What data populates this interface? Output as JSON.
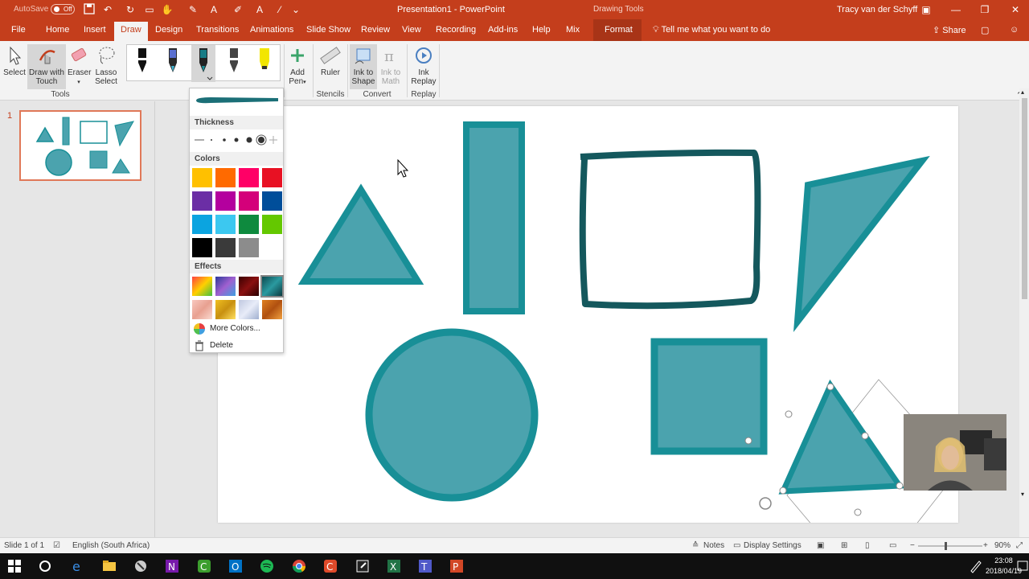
{
  "titlebar": {
    "autosave_label": "AutoSave",
    "autosave_state": "Off",
    "doc_title": "Presentation1 - PowerPoint",
    "contextual_label": "Drawing Tools",
    "user_name": "Tracy van der Schyff",
    "accent": "#c43e1c"
  },
  "tabs": [
    "File",
    "Home",
    "Insert",
    "Draw",
    "Design",
    "Transitions",
    "Animations",
    "Slide Show",
    "Review",
    "View",
    "Recording",
    "Add-ins",
    "Help",
    "Mix",
    "Format"
  ],
  "active_tab": "Draw",
  "tell_me": "Tell me what you want to do",
  "share_label": "Share",
  "ribbon": {
    "select": "Select",
    "draw_with_touch_1": "Draw with",
    "draw_with_touch_2": "Touch",
    "eraser": "Eraser",
    "lasso_1": "Lasso",
    "lasso_2": "Select",
    "tools_group": "Tools",
    "add_pen_1": "Add",
    "add_pen_2": "Pen",
    "ruler": "Ruler",
    "stencils_group": "Stencils",
    "ink_to_shape_1": "Ink to",
    "ink_to_shape_2": "Shape",
    "ink_to_math_1": "Ink to",
    "ink_to_math_2": "Math",
    "convert_group": "Convert",
    "ink_replay_1": "Ink",
    "ink_replay_2": "Replay",
    "replay_group": "Replay"
  },
  "pen_dropdown": {
    "thickness_heading": "Thickness",
    "colors_heading": "Colors",
    "effects_heading": "Effects",
    "more_colors": "More Colors...",
    "delete": "Delete",
    "colors": [
      "#ffc000",
      "#ff6a00",
      "#ff0066",
      "#e81123",
      "#6b2ea5",
      "#b4009e",
      "#d4007a",
      "#004e9a",
      "#0ba4e0",
      "#3cc8f0",
      "#0e8a3e",
      "#64c800",
      "#000000",
      "#3a3a3a",
      "#8c8c8c",
      "#ffffff"
    ]
  },
  "slide_number": "1",
  "statusbar": {
    "slide_of": "Slide 1 of 1",
    "language": "English (South Africa)",
    "notes": "Notes",
    "display_settings": "Display Settings",
    "zoom": "90%"
  },
  "taskbar": {
    "time": "23:08",
    "date": "2018/04/19"
  },
  "shape_color": "#4ba3ae",
  "shape_outline": "#188f97"
}
